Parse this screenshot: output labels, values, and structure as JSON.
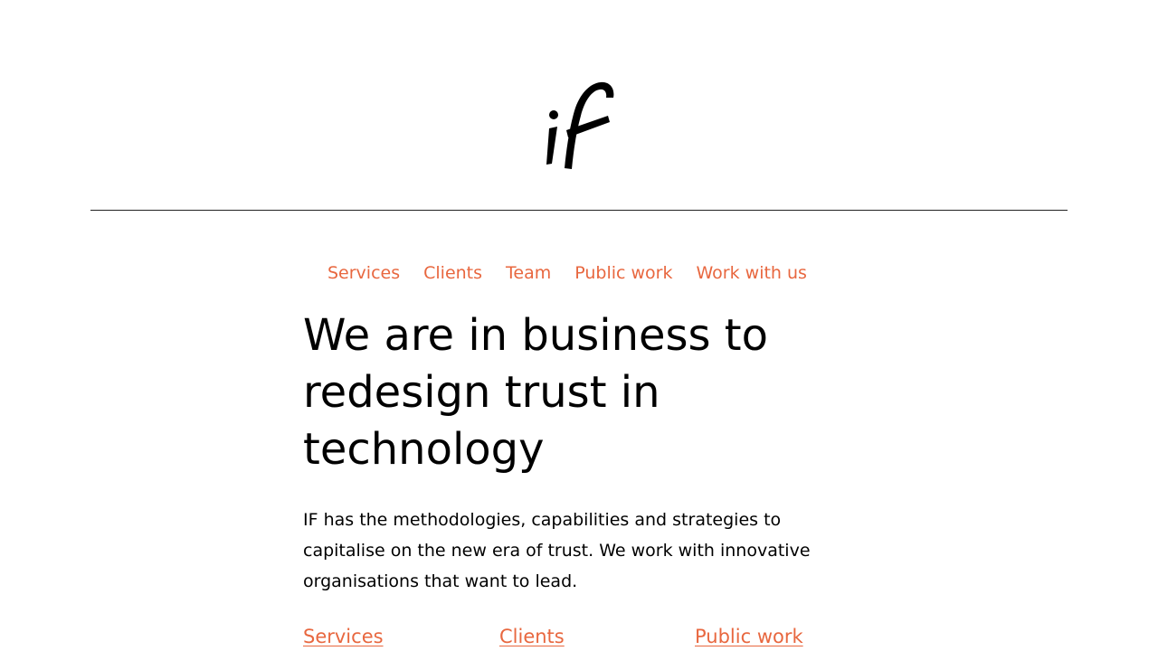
{
  "brand": {
    "logo_text": "if",
    "logo_icon": "if-logo",
    "color": "#000000"
  },
  "nav": {
    "items": [
      {
        "label": "Services"
      },
      {
        "label": "Clients"
      },
      {
        "label": "Team"
      },
      {
        "label": "Public work"
      },
      {
        "label": "Work with us"
      }
    ],
    "link_color": "#e8673f"
  },
  "hero": {
    "headline_lines": [
      "We are in business to",
      "redesign trust in",
      "technology"
    ],
    "intro_lines": [
      "IF has the methodologies, capabilities and strategies to",
      "capitalise on the new era of trust. We work with innovative",
      "organisations that want to lead."
    ]
  },
  "section_links": [
    {
      "label": "Services"
    },
    {
      "label": "Clients"
    },
    {
      "label": "Public work"
    }
  ]
}
